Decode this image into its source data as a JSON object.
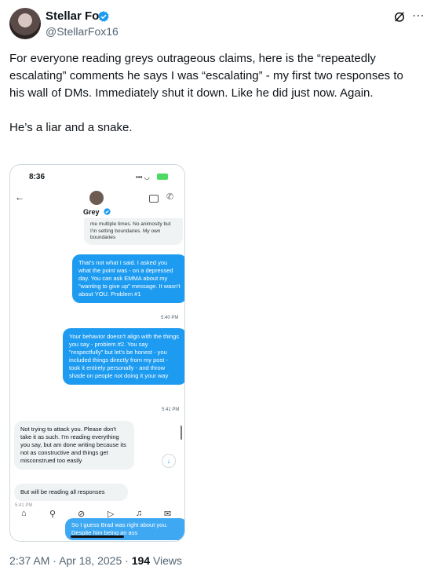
{
  "tweet": {
    "author_name": "Stellar Fox",
    "handle": "@StellarFox16",
    "text": "For everyone reading greys outrageous claims, here is the “repeatedly escalating” comments he says I was “escalating” - my first two responses to his wall of DMs. Immediately shut it down. Like he did just now. Again.\n\nHe’s a liar and a snake.",
    "time": "2:37 AM",
    "separator1": "·",
    "date": "Apr 18, 2025",
    "separator2": "·",
    "views_count": "194",
    "views_label": "Views",
    "more_icon": "⋯",
    "accent_color": "#1d9bf0"
  },
  "media": {
    "status_time": "8:36",
    "contact_name": "Grey",
    "back_icon": "←",
    "phone_icon": "✆",
    "messages": [
      {
        "side": "left",
        "text": "me multiple times. No animosity but I'm setting boundaries. My own boundaries"
      },
      {
        "side": "right",
        "text": "That's not what I said. I asked you what the point was - on a depressed day. You can ask EMMA about my \"wanting to give up\" message. It wasn't about YOU. Problem #1",
        "time": "5:40 PM"
      },
      {
        "side": "right",
        "text": "Your behavior doesn't align with the things you say - problem #2. You say \"respectfully\" but let's be honest - you included things directly from my post - took it entirely personally - and throw shade on people not doing it your way",
        "time": "5:41 PM"
      },
      {
        "side": "left",
        "text": "Not trying to attack you. Please don't take it as such. I'm reading everything you say, but am done writing because its not as constructive and things get misconstrued too easily"
      },
      {
        "side": "left",
        "text": "But will be reading all responses",
        "time": "5:41 PM"
      },
      {
        "side": "right",
        "text": "So I guess Brad was right about you. Despite him being an ass"
      }
    ],
    "scroll_down_icon": "↓",
    "nav_icons": [
      "home-icon",
      "search-icon",
      "grok-icon",
      "play-icon",
      "notifications-icon",
      "messages-icon"
    ]
  }
}
